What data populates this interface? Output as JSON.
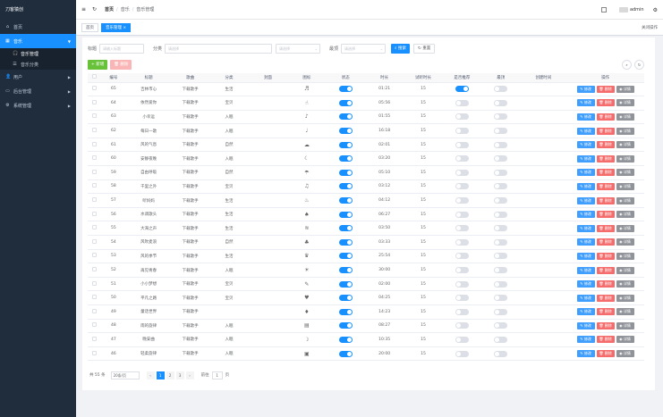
{
  "sidebar": {
    "logo": "刀客猿创",
    "items": [
      {
        "label": "首页",
        "icon": "home-icon"
      },
      {
        "label": "音乐",
        "icon": "grid-icon",
        "active": true,
        "children": [
          {
            "label": "音乐管理",
            "icon": "headphones-icon",
            "current": true
          },
          {
            "label": "音乐分类",
            "icon": "list-icon"
          }
        ]
      },
      {
        "label": "用户",
        "icon": "user-icon"
      },
      {
        "label": "后台管理",
        "icon": "monitor-icon"
      },
      {
        "label": "系统管理",
        "icon": "gear-icon"
      }
    ]
  },
  "topbar": {
    "breadcrumb": [
      "首页",
      "音乐",
      "音乐管理"
    ],
    "username": "admin"
  },
  "tags": [
    {
      "label": "首页",
      "active": false
    },
    {
      "label": "音乐管理",
      "active": true
    }
  ],
  "tags_close": "关闭操作",
  "search": {
    "title_label": "标题",
    "title_placeholder": "请输入标题",
    "category_label": "分类",
    "category_placeholder": "请选择",
    "dropdown2_placeholder": "请选择",
    "recommend_label": "最顶",
    "recommend_placeholder": "请选择",
    "search_btn": "搜索",
    "reset_btn": "重置"
  },
  "toolbar": {
    "add": "新增",
    "delete": "删除"
  },
  "table": {
    "headers": [
      "",
      "编号",
      "标题",
      "歌曲",
      "分类",
      "封面",
      "图标",
      "状态",
      "时长",
      "试听时长",
      "是否推荐",
      "最顶",
      "创建时间",
      "操作"
    ],
    "rows": [
      {
        "id": "65",
        "title": "吉林市心",
        "song": "下载歌手",
        "category": "生活",
        "time": "01:21",
        "trial": "15",
        "status": true,
        "rec": true
      },
      {
        "id": "64",
        "title": "依然爱你",
        "song": "下载歌手",
        "category": "宝贝",
        "time": "05:56",
        "trial": "15",
        "status": true,
        "rec": false
      },
      {
        "id": "63",
        "title": "小幸运",
        "song": "下载歌手",
        "category": "入眠",
        "time": "01:55",
        "trial": "15",
        "status": true,
        "rec": false
      },
      {
        "id": "62",
        "title": "每日一歌",
        "song": "下载歌手",
        "category": "入眠",
        "time": "16:18",
        "trial": "15",
        "status": true,
        "rec": false
      },
      {
        "id": "61",
        "title": "风的气息",
        "song": "下载歌手",
        "category": "自然",
        "time": "02:01",
        "trial": "15",
        "status": true,
        "rec": false
      },
      {
        "id": "60",
        "title": "安静夜晚",
        "song": "下载歌手",
        "category": "入眠",
        "time": "03:20",
        "trial": "15",
        "status": true,
        "rec": false
      },
      {
        "id": "59",
        "title": "自由呼吸",
        "song": "下载歌手",
        "category": "自然",
        "time": "05:10",
        "trial": "15",
        "status": true,
        "rec": false
      },
      {
        "id": "58",
        "title": "千里之外",
        "song": "下载歌手",
        "category": "宝贝",
        "time": "03:12",
        "trial": "15",
        "status": true,
        "rec": false
      },
      {
        "id": "57",
        "title": "听妈妈",
        "song": "下载歌手",
        "category": "生活",
        "time": "04:12",
        "trial": "15",
        "status": true,
        "rec": false
      },
      {
        "id": "56",
        "title": "水调歌头",
        "song": "下载歌手",
        "category": "生活",
        "time": "06:27",
        "trial": "15",
        "status": true,
        "rec": false
      },
      {
        "id": "55",
        "title": "大海之声",
        "song": "下载歌手",
        "category": "生活",
        "time": "03:50",
        "trial": "15",
        "status": true,
        "rec": false
      },
      {
        "id": "54",
        "title": "风吹麦浪",
        "song": "下载歌手",
        "category": "自然",
        "time": "03:33",
        "trial": "15",
        "status": true,
        "rec": false
      },
      {
        "id": "53",
        "title": "风的季节",
        "song": "下载歌手",
        "category": "生活",
        "time": "25:54",
        "trial": "15",
        "status": true,
        "rec": false
      },
      {
        "id": "52",
        "title": "再见青春",
        "song": "下载歌手",
        "category": "入眠",
        "time": "30:00",
        "trial": "15",
        "status": true,
        "rec": false
      },
      {
        "id": "51",
        "title": "小小梦想",
        "song": "下载歌手",
        "category": "宝贝",
        "time": "02:00",
        "trial": "15",
        "status": true,
        "rec": false
      },
      {
        "id": "50",
        "title": "平凡之路",
        "song": "下载歌手",
        "category": "宝贝",
        "time": "04:25",
        "trial": "15",
        "status": true,
        "rec": false
      },
      {
        "id": "49",
        "title": "童话世界",
        "song": "下载歌手",
        "category": "",
        "time": "14:23",
        "trial": "15",
        "status": true,
        "rec": false
      },
      {
        "id": "48",
        "title": "雨的旋律",
        "song": "下载歌手",
        "category": "入眠",
        "time": "08:27",
        "trial": "15",
        "status": true,
        "rec": false
      },
      {
        "id": "47",
        "title": "晚安曲",
        "song": "下载歌手",
        "category": "入眠",
        "time": "10:35",
        "trial": "15",
        "status": true,
        "rec": false
      },
      {
        "id": "46",
        "title": "轻柔旋律",
        "song": "下载歌手",
        "category": "入眠",
        "time": "20:00",
        "trial": "15",
        "status": true,
        "rec": false
      }
    ],
    "ops": {
      "edit": "修改",
      "del": "删除",
      "view": "详情"
    }
  },
  "pagination": {
    "total": "共 55 条",
    "page_size": "20条/页",
    "pages": [
      "1",
      "2",
      "3"
    ],
    "current": "1",
    "jump_label": "前往",
    "jump_value": "1",
    "jump_suffix": "页"
  }
}
